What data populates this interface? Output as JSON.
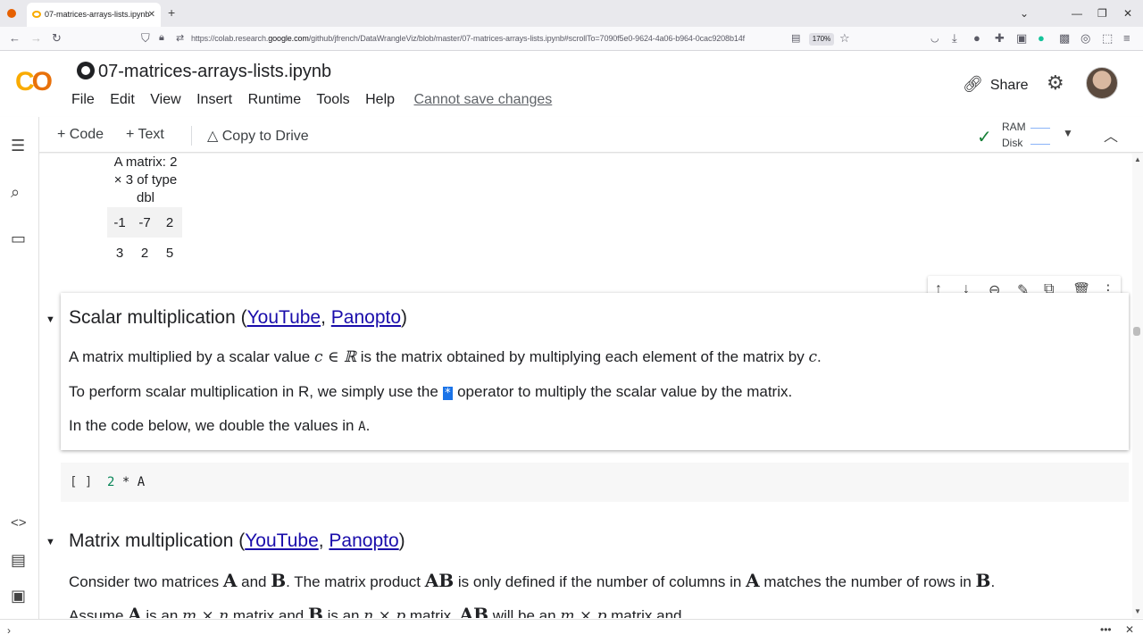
{
  "browser": {
    "tab_title": "07-matrices-arrays-lists.ipynb",
    "url_prefix": "https://colab.research.",
    "url_domain": "google.com",
    "url_rest": "/github/jfrench/DataWrangleViz/blob/master/07-matrices-arrays-lists.ipynb#scrollTo=7090f5e0-9624-4a06-b964-0cac9208b14f",
    "zoom": "170%"
  },
  "header": {
    "notebook_title": "07-matrices-arrays-lists.ipynb",
    "menu": [
      "File",
      "Edit",
      "View",
      "Insert",
      "Runtime",
      "Tools",
      "Help"
    ],
    "save_status": "Cannot save changes",
    "share_label": "Share"
  },
  "toolbar": {
    "code_label": "Code",
    "text_label": "Text",
    "copy_label": "Copy to Drive",
    "ram_label": "RAM",
    "disk_label": "Disk"
  },
  "matrix_output": {
    "caption_lines": [
      "A matrix: 2",
      "× 3 of type",
      "dbl"
    ],
    "rows": [
      [
        "-1",
        "-7",
        "2"
      ],
      [
        "3",
        "2",
        "5"
      ]
    ]
  },
  "section_scalar": {
    "title_main": "Scalar multiplication (",
    "link_youtube": "YouTube",
    "comma": ", ",
    "link_panopto": "Panopto",
    "close": ")",
    "p1_a": "A matrix multiplied by a scalar value ",
    "p1_math": "c ∈ ℝ",
    "p1_b": " is the matrix obtained by multiplying each element of the matrix by ",
    "p1_c": "c",
    "p1_end": ".",
    "p2_a": "To perform scalar multiplication in R, we simply use the ",
    "p2_op": "*",
    "p2_b": " operator to multiply the scalar value by the matrix.",
    "p3_a": "In the code below, we double the values in ",
    "p3_code": "A",
    "p3_end": "."
  },
  "code_cell": {
    "run_marker": "[ ]",
    "number": "2",
    "rest": " * A"
  },
  "section_matrix": {
    "title_main": "Matrix multiplication (",
    "link_youtube": "YouTube",
    "comma": ", ",
    "link_panopto": "Panopto",
    "close": ")",
    "p1_a": "Consider two matrices ",
    "A": "A",
    "and": " and ",
    "B": "B",
    "p1_b": ". The matrix product ",
    "AB": "AB",
    "p1_c": " is only defined if the number of columns in ",
    "p1_d": " matches the number of rows in ",
    "p1_end": ".",
    "p2_a": "Assume ",
    "p2_b": " is an ",
    "mxn": "m × n",
    "p2_c": " matrix and ",
    "nxp": "n × p",
    "p2_d": " matrix. ",
    "p2_e": " will be an ",
    "mxp": "m × p",
    "p2_f": " matrix and"
  }
}
